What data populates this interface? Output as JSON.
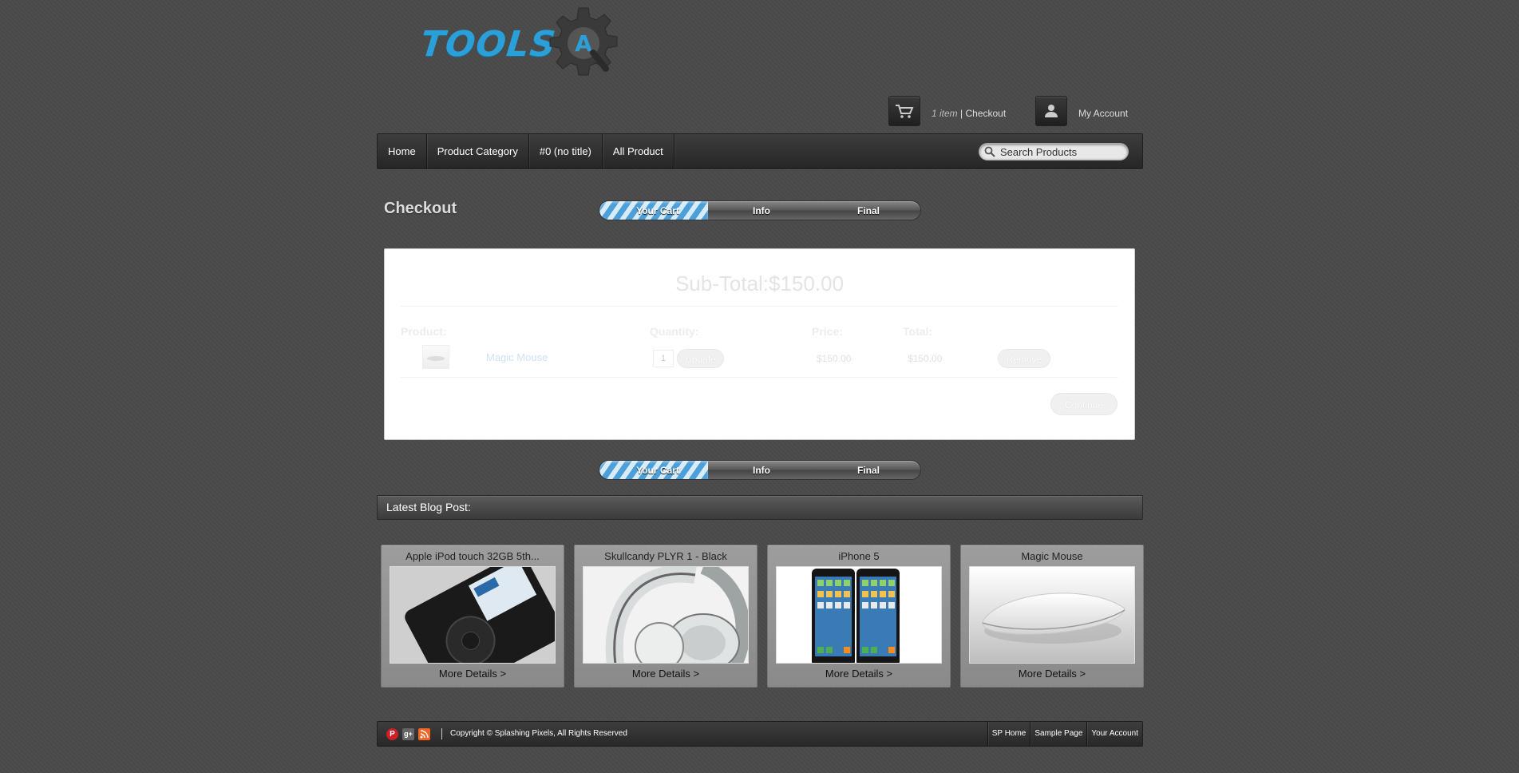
{
  "logo": {
    "text": "TOOLS",
    "gear_letter": "A"
  },
  "header": {
    "cart_count": "1 item",
    "cart_separator": " | ",
    "cart_link": "Checkout",
    "account_link": "My Account"
  },
  "nav": {
    "items": [
      {
        "label": "Home"
      },
      {
        "label": "Product Category"
      },
      {
        "label": "#0 (no title)"
      },
      {
        "label": "All Product"
      }
    ],
    "search_placeholder": "Search Products"
  },
  "checkout": {
    "title": "Checkout",
    "steps": [
      "Your Cart",
      "Info",
      "Final"
    ],
    "current_step_fraction": 0.33,
    "subtotal_label": "Sub-Total:",
    "subtotal_value": "$150.00",
    "columns": {
      "product": "Product:",
      "quantity": "Quantity:",
      "price": "Price:",
      "total": "Total:"
    },
    "items": [
      {
        "name": "Magic Mouse",
        "quantity": "1",
        "price": "$150.00",
        "total": "$150.00"
      }
    ],
    "update_label": "Update",
    "remove_label": "Remove",
    "continue_label": "Continue"
  },
  "blog": {
    "heading": "Latest Blog Post:",
    "cards": [
      {
        "title": "Apple iPod touch 32GB 5th...",
        "link": "More Details >"
      },
      {
        "title": "Skullcandy PLYR 1 - Black",
        "link": "More Details >"
      },
      {
        "title": "iPhone 5",
        "link": "More Details >"
      },
      {
        "title": "Magic Mouse",
        "link": "More Details >"
      }
    ]
  },
  "footer": {
    "copyright": "Copyright © Splashing Pixels, All Rights Reserved",
    "links": [
      "SP Home",
      "Sample Page",
      "Your Account"
    ],
    "social": {
      "pinterest": "P",
      "googleplus": "g+"
    }
  },
  "colors": {
    "accent": "#2a9fd8",
    "background": "#4a4a4a"
  }
}
